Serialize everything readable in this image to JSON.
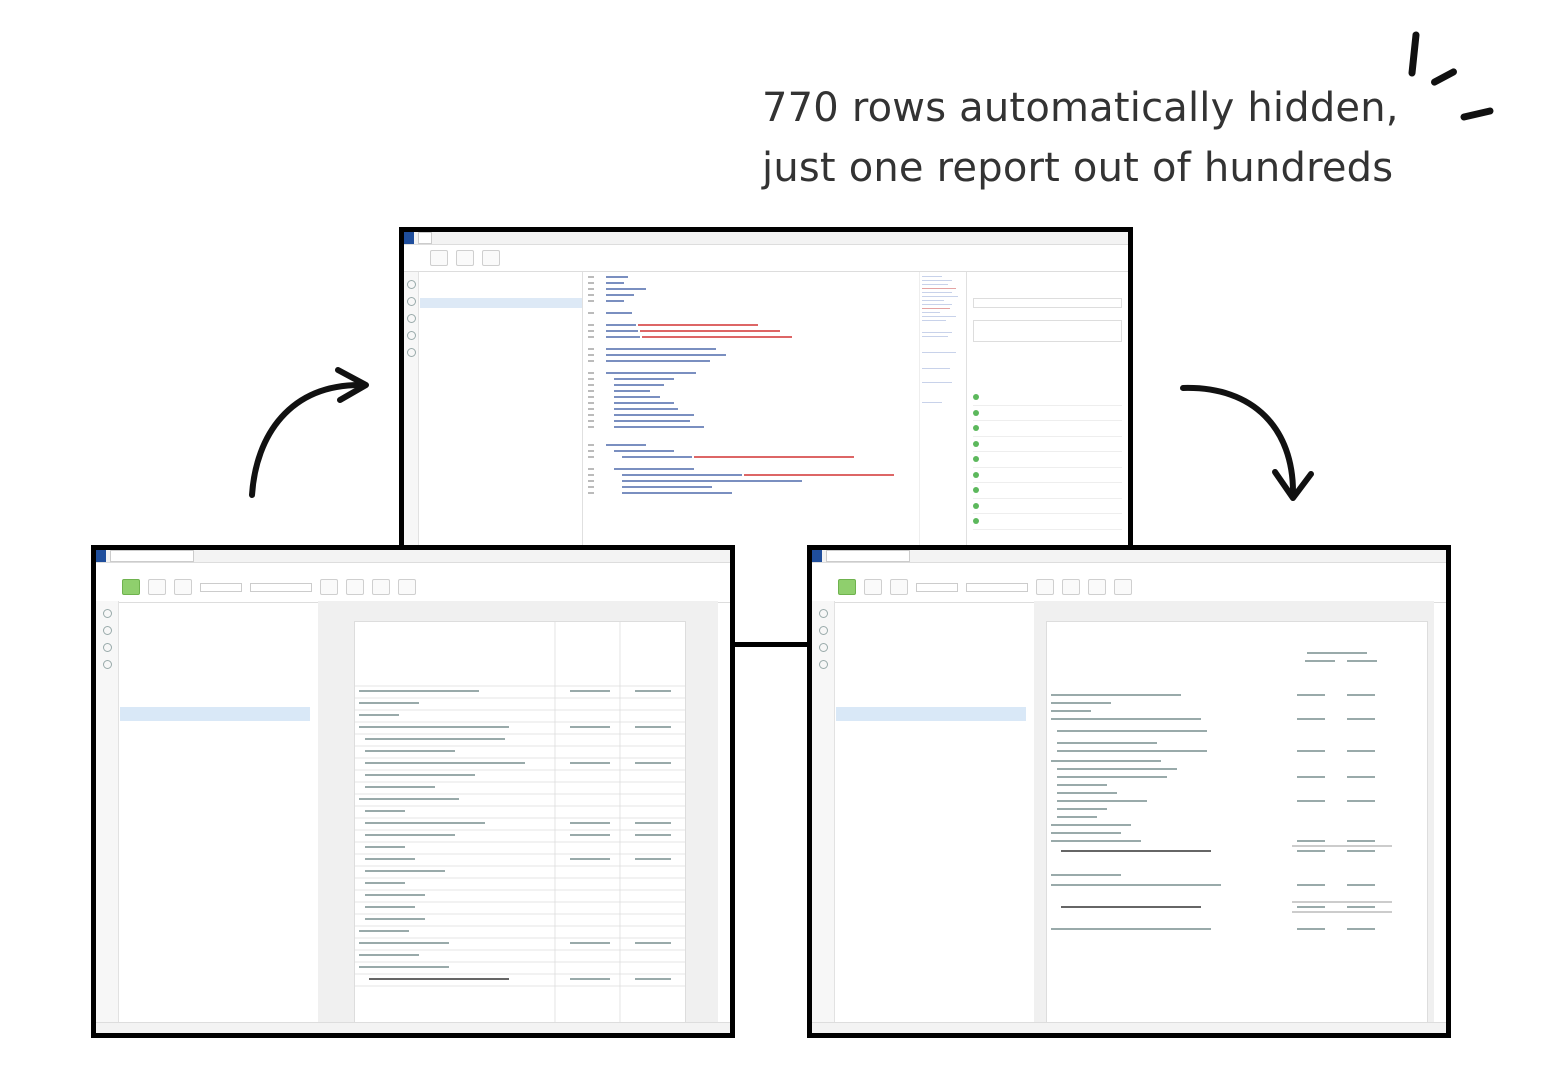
{
  "headline": {
    "line1": "770 rows automatically hidden,",
    "line2": "just one report out of hundreds"
  },
  "colors": {
    "frame": "#000000",
    "accent": "#1f4e9c",
    "selection": "#d9e8f7",
    "success": "#5cb85c"
  }
}
